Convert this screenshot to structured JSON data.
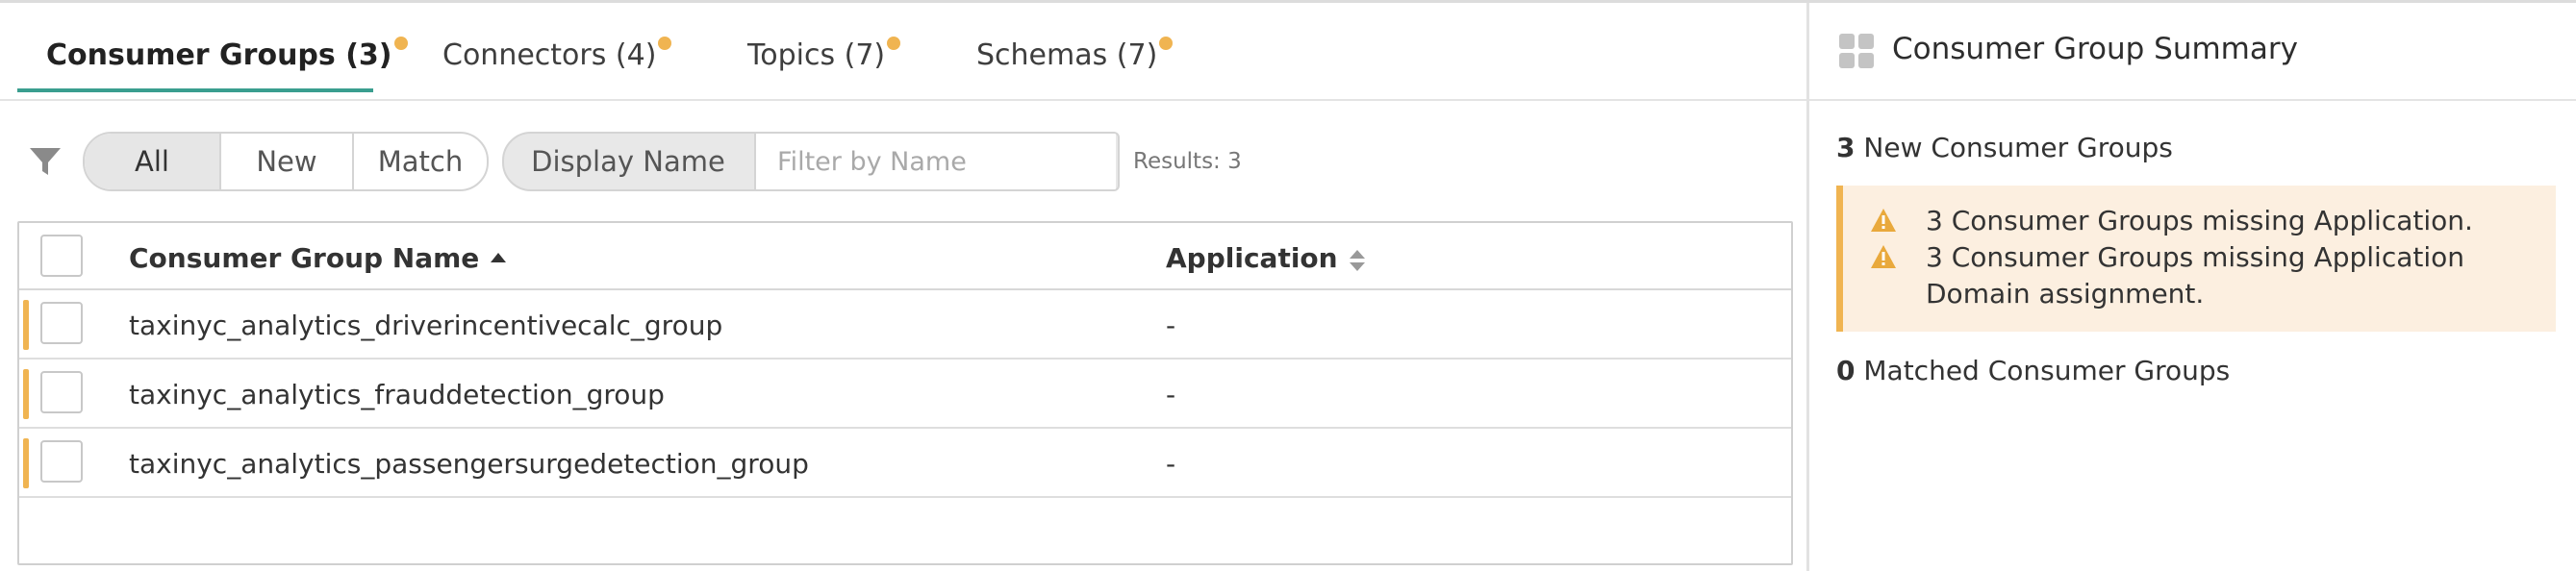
{
  "tabs": [
    {
      "label": "Consumer Groups (3)",
      "active": true
    },
    {
      "label": "Connectors (4)",
      "active": false
    },
    {
      "label": "Topics (7)",
      "active": false
    },
    {
      "label": "Schemas (7)",
      "active": false
    }
  ],
  "filters": {
    "segments": [
      "All",
      "New",
      "Match"
    ],
    "selected": "All",
    "name_filter_label": "Display Name",
    "name_filter_placeholder": "Filter by Name",
    "results": "Results: 3"
  },
  "table": {
    "columns": [
      {
        "label": "Consumer Group Name",
        "sort": "ascending"
      },
      {
        "label": "Application",
        "sort": "none"
      }
    ],
    "rows": [
      {
        "name": "taxinyc_analytics_driverincentivecalc_group",
        "application": "-"
      },
      {
        "name": "taxinyc_analytics_frauddetection_group",
        "application": "-"
      },
      {
        "name": "taxinyc_analytics_passengersurgedetection_group",
        "application": "-"
      }
    ]
  },
  "summary": {
    "title": "Consumer Group Summary",
    "new_count": "3",
    "new_label": "New Consumer Groups",
    "warnings": [
      "3 Consumer Groups missing Application.",
      "3 Consumer Groups missing Application Domain assignment."
    ],
    "matched_count": "0",
    "matched_label": "Matched Consumer Groups"
  },
  "colors": {
    "accent": "#3a9e8f",
    "new_indicator": "#f0b451",
    "warning_bg": "#fcefe0"
  },
  "icons": [
    "filter-icon",
    "sort-ascending-icon",
    "sort-icon",
    "summary-icon",
    "warning-icon"
  ]
}
